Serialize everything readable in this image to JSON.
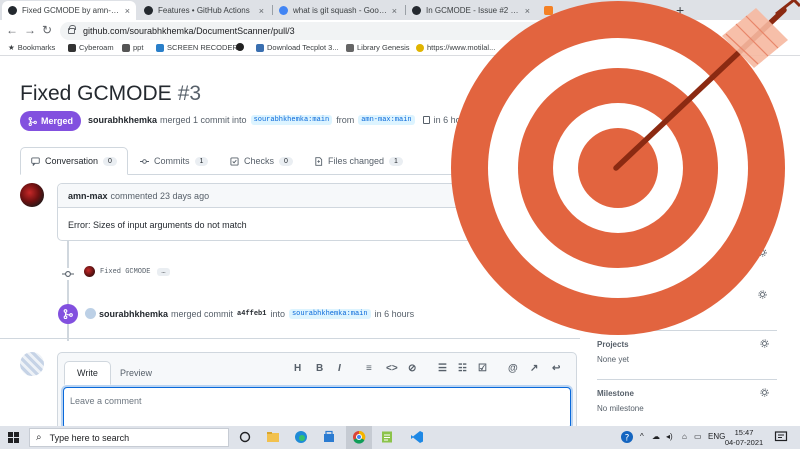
{
  "browser": {
    "tabs": [
      {
        "title": "Fixed GCMODE by amn-max · ",
        "active": true
      },
      {
        "title": "Features • GitHub Actions",
        "active": false
      },
      {
        "title": "what is git squash - Google Se",
        "active": false
      },
      {
        "title": "In GCMODE - Issue #2 - sourab",
        "active": false
      },
      {
        "title": "",
        "active": false
      }
    ],
    "url": "github.com/sourabhkhemka/DocumentScanner/pull/3",
    "bookmarks": [
      "Bookmarks",
      "Cyberoam",
      "ppt",
      "SCREEN RECODER",
      "Download Tecplot 3...",
      "Library Genesis",
      "https://www.motilal..."
    ]
  },
  "pr": {
    "title": "Fixed GCMODE",
    "number": "#3",
    "status": "Merged",
    "author": "sourabhkhemka",
    "meta_text": "merged 1 commit into",
    "base_branch": "sourabhkhemka:main",
    "from_text": "from",
    "head_branch": "amn-max:main",
    "time": "in 6 hours"
  },
  "tabs": {
    "conversation": {
      "label": "Conversation",
      "count": "0"
    },
    "commits": {
      "label": "Commits",
      "count": "1"
    },
    "checks": {
      "label": "Checks",
      "count": "0"
    },
    "files": {
      "label": "Files changed",
      "count": "1"
    }
  },
  "comment": {
    "author": "amn-max",
    "when": "commented 23 days ago",
    "body": "Error: Sizes of input arguments do not match"
  },
  "commit": {
    "message": "Fixed GCMODE",
    "more": "…"
  },
  "merge_event": {
    "author": "sourabhkhemka",
    "text1": "merged commit",
    "sha": "a4ffeb1",
    "text2": "into",
    "branch": "sourabhkhemka:main",
    "time": "in 6 hours"
  },
  "editor": {
    "tab_write": "Write",
    "tab_preview": "Preview",
    "placeholder": "Leave a comment",
    "tools": {
      "heading": "H",
      "bold": "B",
      "italic": "I"
    }
  },
  "sidebar": {
    "projects_title": "Projects",
    "projects_value": "None yet",
    "milestone_title": "Milestone",
    "milestone_value": "No milestone"
  },
  "taskbar": {
    "search_placeholder": "Type here to search",
    "lang": "ENG",
    "time": "15:47",
    "date": "04-07-2021"
  },
  "colors": {
    "merged": "#8250df",
    "link": "#0969da",
    "target_red": "#e2643f",
    "target_white": "#ffffff",
    "arrow": "#8b2a12",
    "fletching": "#f6b8a0"
  }
}
